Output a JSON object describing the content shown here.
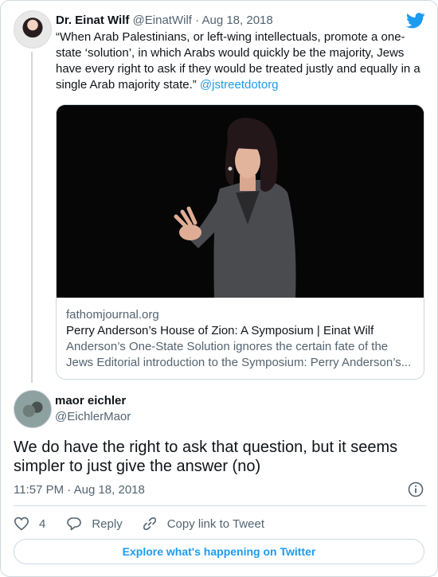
{
  "quoted_tweet": {
    "author_name": "Dr. Einat Wilf",
    "author_handle": "@EinatWilf",
    "separator": "·",
    "date": "Aug 18, 2018",
    "text": "“When Arab Palestinians, or left-wing intellectuals, promote a one-state ‘solution’, in which Arabs would quickly be the majority, Jews have every right to ask if they would be treated justly and equally in a single Arab majority state.” ",
    "mention": "@jstreetdotorg",
    "link_card": {
      "domain": "fathomjournal.org",
      "title": "Perry Anderson’s House of Zion: A Symposium | Einat Wilf",
      "description_line1": "Anderson’s One-State Solution ignores the certain fate of the",
      "description_line2": "Jews Editorial introduction to the Symposium: Perry Anderson’s..."
    }
  },
  "reply_tweet": {
    "author_name": "maor eichler",
    "author_handle": "@EichlerMaor",
    "text": "We do have the right to ask that question, but it seems simpler to just give the answer (no)",
    "time": "11:57 PM",
    "separator": "·",
    "date": "Aug 18, 2018"
  },
  "actions": {
    "like_count": "4",
    "reply_label": "Reply",
    "copy_link_label": "Copy link to Tweet"
  },
  "explore_label": "Explore what's happening on Twitter",
  "icons": {
    "brand": "twitter-bird-icon",
    "info": "info-icon",
    "like": "heart-icon",
    "reply": "reply-bubble-icon",
    "copy": "link-icon"
  },
  "colors": {
    "accent": "#1d9bf0",
    "text": "#0f1419",
    "secondary": "#536471",
    "border": "#cfd9de"
  }
}
